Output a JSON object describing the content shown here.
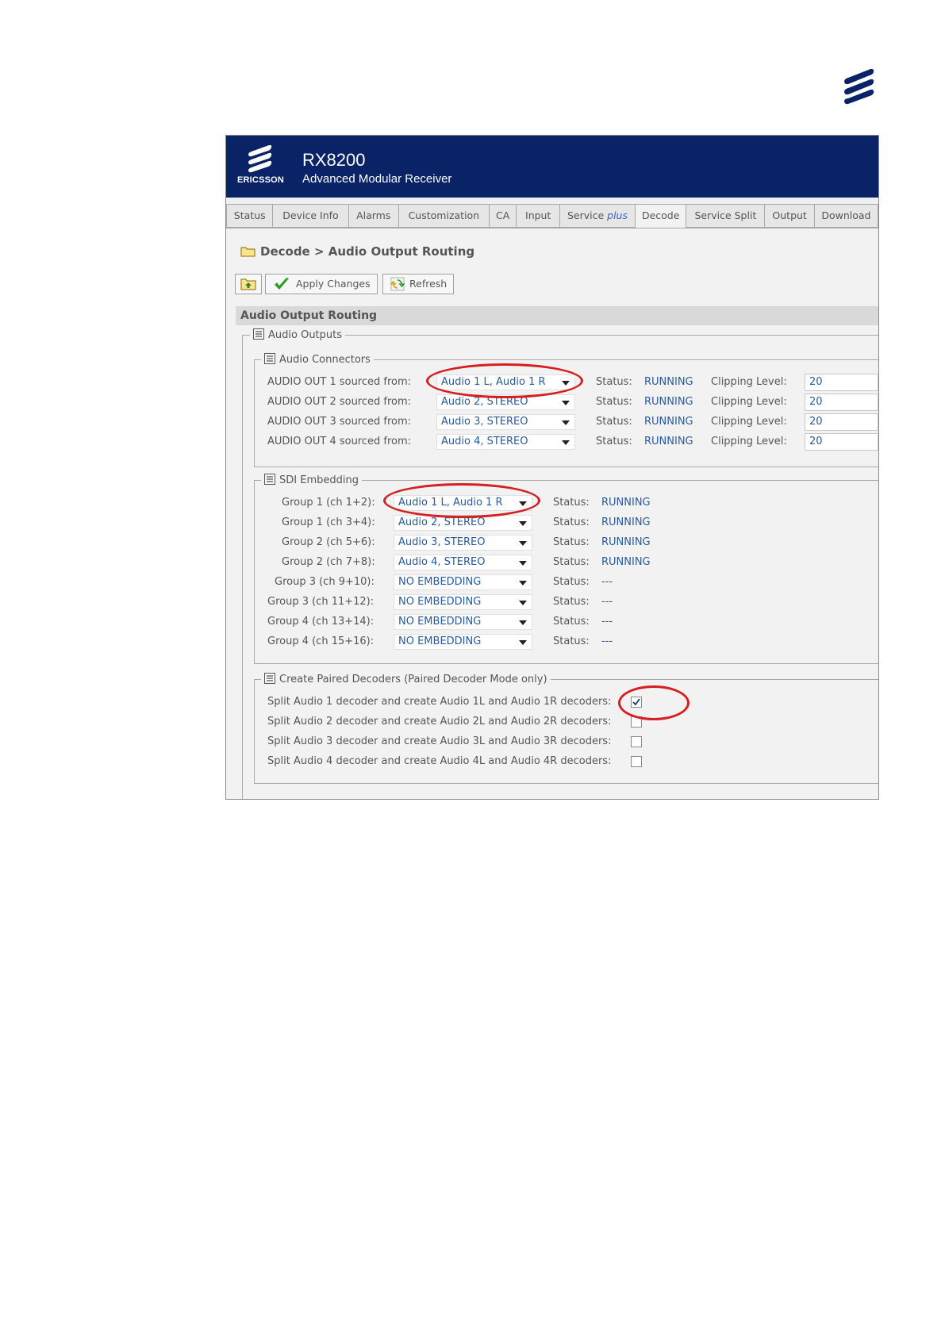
{
  "banner": {
    "brand": "ERICSSON",
    "product": "RX8200",
    "subtitle": "Advanced Modular Receiver"
  },
  "tabs": [
    {
      "label": "Status"
    },
    {
      "label": "Device Info"
    },
    {
      "label": "Alarms"
    },
    {
      "label": "Customization"
    },
    {
      "label": "CA"
    },
    {
      "label": "Input"
    },
    {
      "label": "Service",
      "suffix": "plus"
    },
    {
      "label": "Decode",
      "active": true
    },
    {
      "label": "Service Split"
    },
    {
      "label": "Output"
    },
    {
      "label": "Download"
    }
  ],
  "breadcrumb": "Decode > Audio Output Routing",
  "toolbar": {
    "apply": "Apply Changes",
    "refresh": "Refresh"
  },
  "section_title": "Audio Output Routing",
  "audio_outputs": {
    "legend": "Audio Outputs",
    "connectors": {
      "legend": "Audio Connectors",
      "status_label": "Status:",
      "clip_label": "Clipping Level:",
      "rows": [
        {
          "label": "AUDIO OUT 1 sourced from:",
          "source": "Audio 1 L, Audio 1 R",
          "status": "RUNNING",
          "clip": "20"
        },
        {
          "label": "AUDIO OUT 2 sourced from:",
          "source": "Audio 2, STEREO",
          "status": "RUNNING",
          "clip": "20"
        },
        {
          "label": "AUDIO OUT 3 sourced from:",
          "source": "Audio 3, STEREO",
          "status": "RUNNING",
          "clip": "20"
        },
        {
          "label": "AUDIO OUT 4 sourced from:",
          "source": "Audio 4, STEREO",
          "status": "RUNNING",
          "clip": "20"
        }
      ]
    },
    "sdi": {
      "legend": "SDI Embedding",
      "status_label": "Status:",
      "rows": [
        {
          "label": "Group 1 (ch 1+2):",
          "source": "Audio 1 L, Audio 1 R",
          "status": "RUNNING"
        },
        {
          "label": "Group 1 (ch 3+4):",
          "source": "Audio 2, STEREO",
          "status": "RUNNING"
        },
        {
          "label": "Group 2 (ch 5+6):",
          "source": "Audio 3, STEREO",
          "status": "RUNNING"
        },
        {
          "label": "Group 2 (ch 7+8):",
          "source": "Audio 4, STEREO",
          "status": "RUNNING"
        },
        {
          "label": "Group 3 (ch 9+10):",
          "source": "NO EMBEDDING",
          "status": "---"
        },
        {
          "label": "Group 3 (ch 11+12):",
          "source": "NO EMBEDDING",
          "status": "---"
        },
        {
          "label": "Group 4 (ch 13+14):",
          "source": "NO EMBEDDING",
          "status": "---"
        },
        {
          "label": "Group 4 (ch 15+16):",
          "source": "NO EMBEDDING",
          "status": "---"
        }
      ]
    },
    "paired": {
      "legend": "Create Paired Decoders (Paired Decoder Mode only)",
      "rows": [
        {
          "label": "Split Audio 1 decoder and create Audio 1L and Audio 1R decoders:",
          "checked": true
        },
        {
          "label": "Split Audio 2 decoder and create Audio 2L and Audio 2R decoders:",
          "checked": false
        },
        {
          "label": "Split Audio 3 decoder and create Audio 3L and Audio 3R decoders:",
          "checked": false
        },
        {
          "label": "Split Audio 4 decoder and create Audio 4L and Audio 4R decoders:",
          "checked": false
        }
      ]
    }
  },
  "colors": {
    "banner": "#0a2366",
    "highlight_ring": "#d42020",
    "value_text": "#2a5a9a"
  }
}
